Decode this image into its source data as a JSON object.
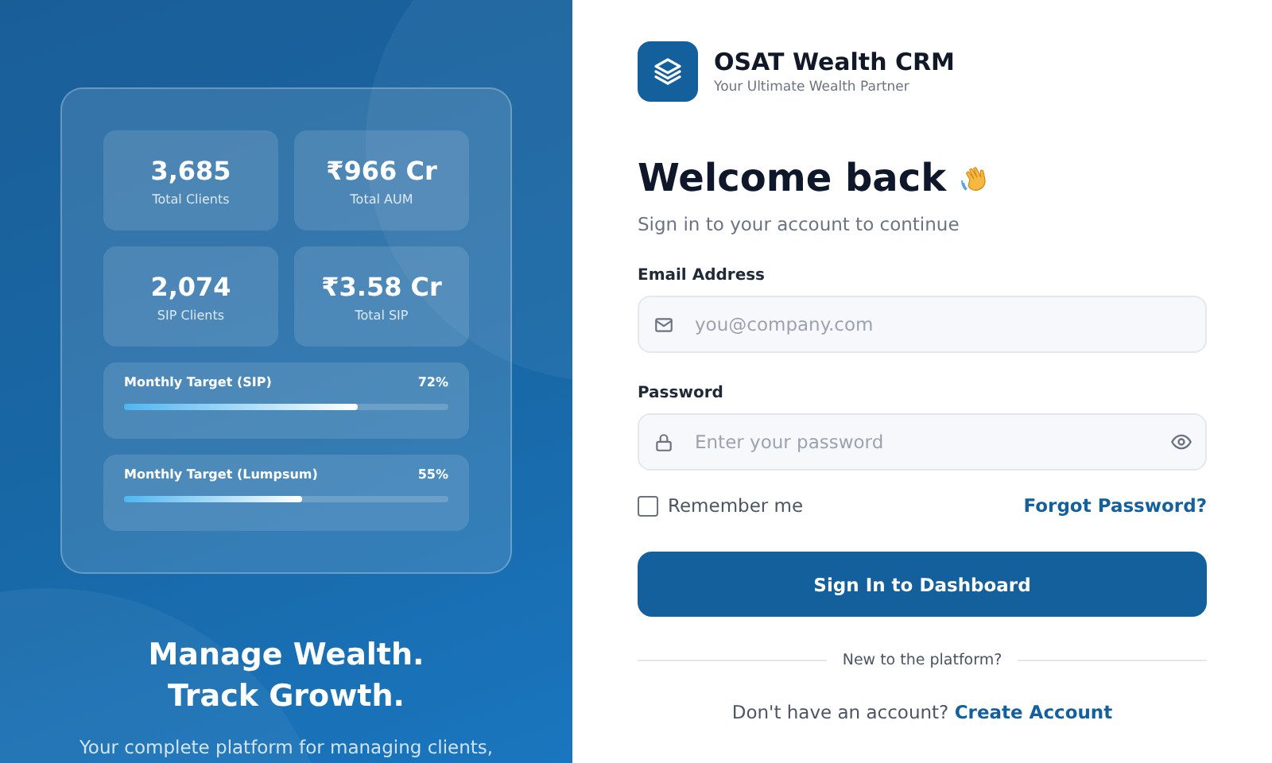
{
  "hero": {
    "stats": [
      {
        "value": "3,685",
        "label": "Total Clients"
      },
      {
        "value": "₹966 Cr",
        "label": "Total AUM"
      },
      {
        "value": "2,074",
        "label": "SIP Clients"
      },
      {
        "value": "₹3.58 Cr",
        "label": "Total SIP"
      }
    ],
    "targets": [
      {
        "label": "Monthly Target (SIP)",
        "reading": "72%",
        "level": 0.72
      },
      {
        "label": "Monthly Target (Lumpsum)",
        "reading": "55%",
        "level": 0.55
      }
    ],
    "headline": [
      "Manage Wealth.",
      "Track Growth."
    ],
    "tagline": "Your complete platform for managing clients,"
  },
  "brand": {
    "name": "OSAT Wealth CRM",
    "tagline": "Your Ultimate Wealth Partner"
  },
  "title": "Welcome back",
  "subtitle": "Sign in to your account to continue",
  "fields": [
    {
      "label": "Email Address",
      "placeholder": "you@company.com",
      "kind": "email"
    },
    {
      "label": "Password",
      "placeholder": "Enter your password",
      "kind": "password"
    }
  ],
  "remember": {
    "label": "Remember me",
    "checked": false
  },
  "forgot": "Forgot Password?",
  "submit": "Sign In to Dashboard",
  "divider": "New to the platform?",
  "signup": {
    "prompt": "Don't have an account?",
    "link": "Create Account"
  }
}
